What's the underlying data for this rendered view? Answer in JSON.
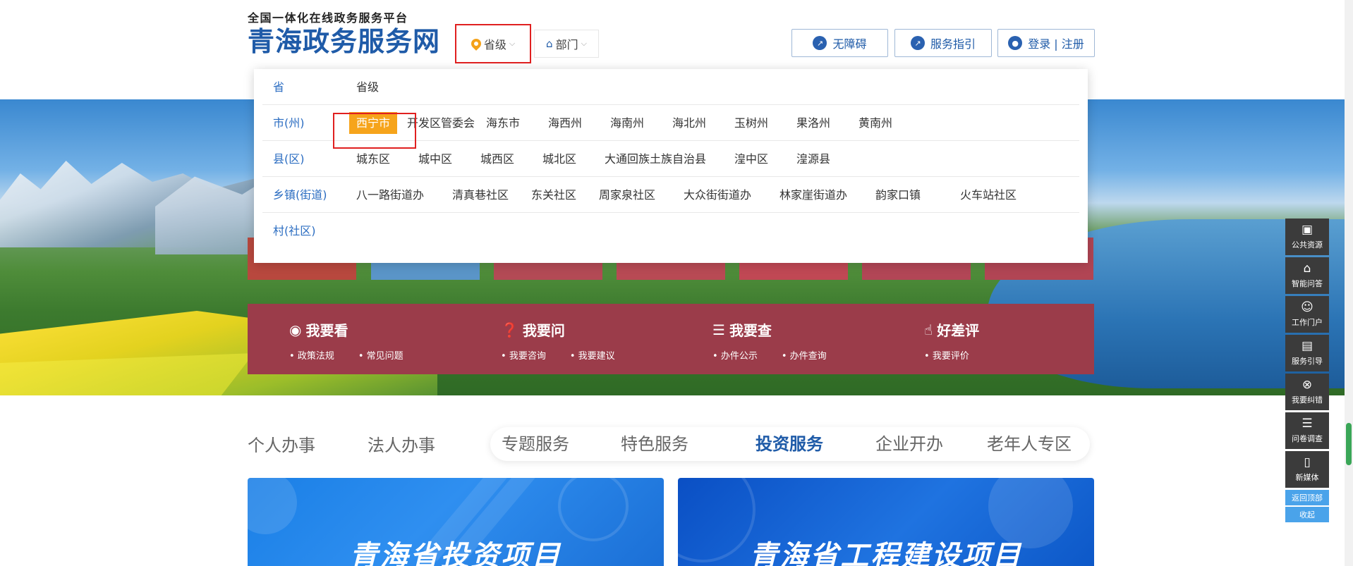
{
  "header": {
    "subtitle": "全国一体化在线政务服务平台",
    "title": "青海政务服务网",
    "region_button": "省级",
    "dept_button": "部门",
    "accessibility": "无障碍",
    "service_guide": "服务指引",
    "login": "登录 | 注册"
  },
  "dropdown": {
    "rows": [
      {
        "label": "省",
        "items": [
          "省级"
        ]
      },
      {
        "label": "市(州)",
        "items": [
          "西宁市",
          "开发区管委会",
          "海东市",
          "海西州",
          "海南州",
          "海北州",
          "玉树州",
          "果洛州",
          "黄南州"
        ],
        "selected": "西宁市"
      },
      {
        "label": "县(区)",
        "items": [
          "城东区",
          "城中区",
          "城西区",
          "城北区",
          "大通回族土族自治县",
          "湟中区",
          "湟源县"
        ]
      },
      {
        "label": "乡镇(街道)",
        "items": [
          "八一路街道办",
          "清真巷社区",
          "东关社区",
          "周家泉社区",
          "大众街街道办",
          "林家崖街道办",
          "韵家口镇",
          "火车站社区"
        ]
      },
      {
        "label": "村(社区)",
        "items": []
      }
    ]
  },
  "panel": {
    "cols": [
      {
        "title": "我要看",
        "icon": "eye-icon",
        "links": [
          "政策法规",
          "常见问题"
        ]
      },
      {
        "title": "我要问",
        "icon": "question-icon",
        "links": [
          "我要咨询",
          "我要建议"
        ]
      },
      {
        "title": "我要查",
        "icon": "search-list-icon",
        "links": [
          "办件公示",
          "办件查询"
        ]
      },
      {
        "title": "好差评",
        "icon": "thumbs-up-icon",
        "links": [
          "我要评价"
        ]
      }
    ]
  },
  "tabs": {
    "left": [
      "个人办事",
      "法人办事"
    ],
    "pill": [
      "专题服务",
      "特色服务",
      "投资服务",
      "企业开办",
      "老年人专区"
    ],
    "active": "投资服务"
  },
  "cards": {
    "left_title": "青海省投资项目",
    "right_title": "青海省工程建设项目"
  },
  "sidebar": {
    "items": [
      {
        "label": "公共资源",
        "icon": "cube-icon"
      },
      {
        "label": "智能问答",
        "icon": "robot-icon"
      },
      {
        "label": "工作门户",
        "icon": "person-icon"
      },
      {
        "label": "服务引导",
        "icon": "book-icon"
      },
      {
        "label": "我要纠错",
        "icon": "close-circle-icon"
      },
      {
        "label": "问卷调查",
        "icon": "clipboard-icon"
      },
      {
        "label": "新媒体",
        "icon": "phone-icon"
      }
    ],
    "back_top": "返回顶部",
    "collapse": "收起"
  },
  "colors": {
    "brand_blue": "#1f5ba8",
    "dropdown_label": "#2a6cc1",
    "selected_bg": "#f6a41b",
    "panel_red": "#9b3c4a",
    "highlight_red": "#e02020",
    "sidebar_dark": "#3b3b3b",
    "sidebar_blue": "#4aa3ea"
  }
}
